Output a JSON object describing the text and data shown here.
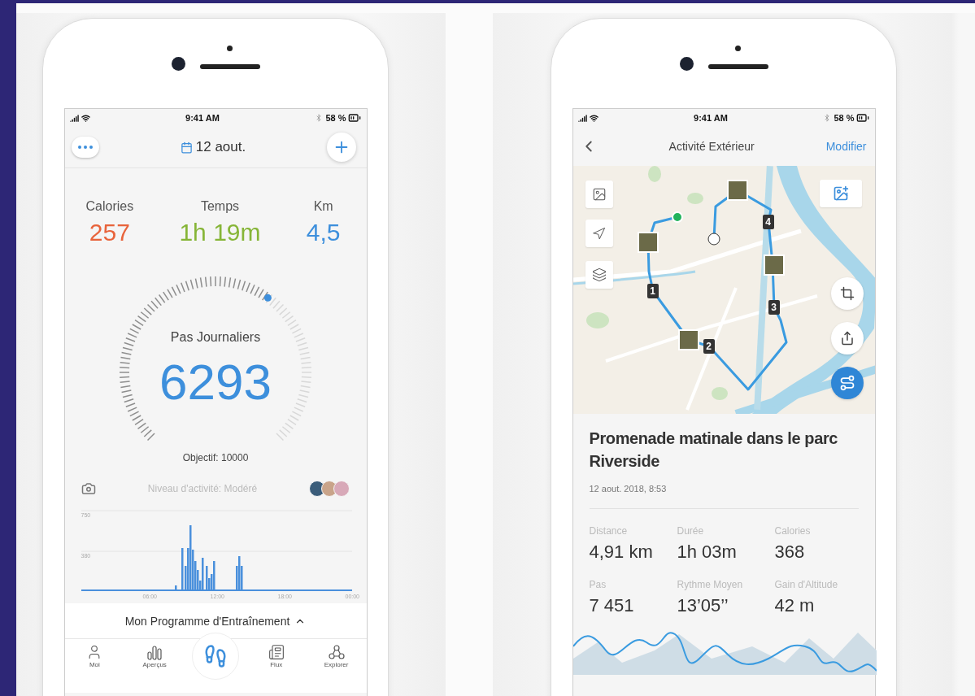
{
  "phones": [
    {
      "kind": "daily",
      "status": {
        "time": "9:41 AM",
        "battery": "58 %"
      },
      "header": {
        "date": "12 aout."
      },
      "stats": [
        {
          "label": "Calories",
          "value": "257",
          "color": "#e8643c"
        },
        {
          "label": "Temps",
          "value": "1h 19m",
          "color": "#86b537"
        },
        {
          "label": "Km",
          "value": "4,5",
          "color": "#3d8fdc"
        }
      ],
      "gauge": {
        "label": "Pas Journaliers",
        "value": "6293",
        "goal": "Objectif: 10000"
      },
      "activity_level": "Niveau d'activité: Modéré",
      "chart": {
        "yticks": [
          "750",
          "380"
        ],
        "xticks": [
          "06:00",
          "12:00",
          "18:00",
          "00:00"
        ]
      },
      "program": "Mon Programme d'Entraînement",
      "tabs": [
        {
          "kind": "plain",
          "label": "Moi",
          "selected": false
        },
        {
          "kind": "plain",
          "label": "Aperçus",
          "selected": false
        },
        {
          "kind": "center",
          "selected": true
        },
        {
          "kind": "plain",
          "label": "Flux",
          "selected": false
        },
        {
          "kind": "plain",
          "label": "Explorer",
          "selected": false
        }
      ]
    },
    {
      "kind": "activity",
      "status": {
        "time": "9:41 AM",
        "battery": "58 %"
      },
      "header": {
        "title": "Activité Extérieur",
        "action": "Modifier"
      },
      "map": {
        "markers": [
          "1",
          "2",
          "3",
          "4"
        ]
      },
      "title": "Promenade matinale dans le parc Riverside",
      "date": "12 aout. 2018, 8:53",
      "stats": [
        {
          "label": "Distance",
          "value": "4,91 km"
        },
        {
          "label": "Durée",
          "value": "1h 03m"
        },
        {
          "label": "Calories",
          "value": "368"
        },
        {
          "label": "Pas",
          "value": "7 451"
        },
        {
          "label": "Rythme Moyen",
          "value": "13’05’’"
        },
        {
          "label": "Gain d'Altitude",
          "value": "42 m"
        }
      ]
    }
  ]
}
